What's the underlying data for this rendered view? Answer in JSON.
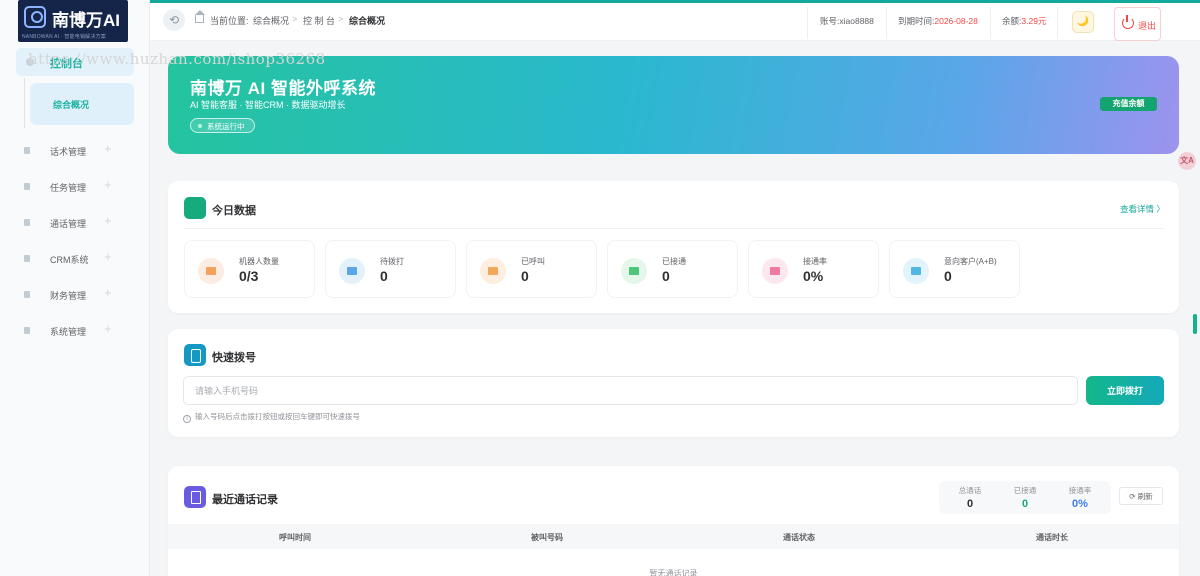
{
  "app": {
    "brand": "南博万AI",
    "slogan": "NANBOWAN AI · 智能电销解决方案",
    "watermark": "https://www.huzhan.com/ishop36268"
  },
  "sidebar": {
    "active_parent": "控制台",
    "active_child": "综合概况",
    "items": [
      {
        "label": "话术管理",
        "icon": "microphone-icon"
      },
      {
        "label": "任务管理",
        "icon": "task-icon"
      },
      {
        "label": "通话管理",
        "icon": "phone-icon"
      },
      {
        "label": "CRM系统",
        "icon": "user-icon"
      },
      {
        "label": "财务管理",
        "icon": "wallet-icon"
      },
      {
        "label": "系统管理",
        "icon": "gear-icon"
      }
    ]
  },
  "header": {
    "breadcrumb_prefix": "当前位置:",
    "breadcrumb": [
      "综合概况",
      "控 制 台",
      "综合概况"
    ],
    "account_label": "账号:",
    "account": "xiao8888",
    "expire_label": "到期时间:",
    "expire": "2026-08-28",
    "balance_label": "余额:",
    "balance": "3.29元",
    "logout": "退出"
  },
  "banner": {
    "title": "南博万 AI 智能外呼系统",
    "subtitle": "AI 智能客服 · 智能CRM · 数据驱动增长",
    "status": "系统运行中",
    "recharge": "充值余额"
  },
  "today": {
    "title": "今日数据",
    "more": "查看详情 〉",
    "stats": [
      {
        "label": "机器人数量",
        "value": "0/3",
        "icon_bg": "#fdece2",
        "icon_fg": "#f3a15b",
        "icon": "robot-icon"
      },
      {
        "label": "待拨打",
        "value": "0",
        "icon_bg": "#e3f1fb",
        "icon_fg": "#5aa6e8",
        "icon": "calendar-icon"
      },
      {
        "label": "已呼叫",
        "value": "0",
        "icon_bg": "#fdeee0",
        "icon_fg": "#f0a85a",
        "icon": "call-out-icon"
      },
      {
        "label": "已接通",
        "value": "0",
        "icon_bg": "#e4f7ea",
        "icon_fg": "#4cc77a",
        "icon": "call-connected-icon"
      },
      {
        "label": "接通率",
        "value": "0%",
        "icon_bg": "#fde7ee",
        "icon_fg": "#ee7aa1",
        "icon": "percent-icon"
      },
      {
        "label": "意向客户(A+B)",
        "value": "0",
        "icon_bg": "#e3f3fb",
        "icon_fg": "#52b6e0",
        "icon": "customer-icon"
      }
    ]
  },
  "dial": {
    "title": "快速拨号",
    "placeholder": "请输入手机号码",
    "button": "立即拨打",
    "hint": "输入号码后点击拨打按钮或按回车键即可快速拨号"
  },
  "recent": {
    "title": "最近通话记录",
    "mini_stats": [
      {
        "label": "总通话",
        "value": "0",
        "color": "#303133"
      },
      {
        "label": "已接通",
        "value": "0",
        "color": "#17a874"
      },
      {
        "label": "接通率",
        "value": "0%",
        "color": "#3d7be8"
      }
    ],
    "refresh": "刷新",
    "columns": [
      "呼叫时间",
      "被叫号码",
      "通话状态",
      "通话时长"
    ],
    "empty": "暂无通话记录"
  },
  "widgets": {
    "translate": "文A",
    "theme_icon": "🌙"
  }
}
